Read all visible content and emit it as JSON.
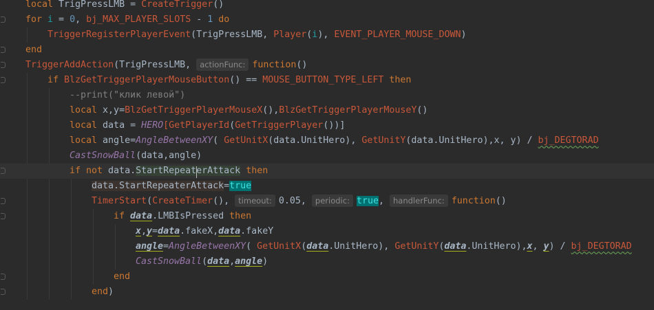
{
  "editor": {
    "language": "lua",
    "current_line": 12,
    "lines": [
      {
        "indent": 0,
        "fold": false,
        "tokens": [
          {
            "t": "local",
            "c": "kw"
          },
          {
            "t": " TrigPressLMB = ",
            "c": "id"
          },
          {
            "t": "CreateTrigger",
            "c": "fn"
          },
          {
            "t": "()",
            "c": "id"
          }
        ]
      },
      {
        "indent": 0,
        "fold": true,
        "tokens": [
          {
            "t": "for ",
            "c": "kw"
          },
          {
            "t": "i",
            "c": "par"
          },
          {
            "t": " = ",
            "c": "id"
          },
          {
            "t": "0",
            "c": "num n"
          },
          {
            "t": ", ",
            "c": "id"
          },
          {
            "t": "bj_MAX_PLAYER_SLOTS",
            "c": "fn"
          },
          {
            "t": " - ",
            "c": "id"
          },
          {
            "t": "1",
            "c": "num n"
          },
          {
            "t": " do",
            "c": "kw"
          }
        ]
      },
      {
        "indent": 1,
        "fold": false,
        "tokens": [
          {
            "t": "TriggerRegisterPlayerEvent",
            "c": "fn"
          },
          {
            "t": "(TrigPressLMB, ",
            "c": "id"
          },
          {
            "t": "Player",
            "c": "fn"
          },
          {
            "t": "(",
            "c": "id"
          },
          {
            "t": "i",
            "c": "par"
          },
          {
            "t": "), ",
            "c": "id"
          },
          {
            "t": "EVENT_PLAYER_MOUSE_DOWN",
            "c": "fn"
          },
          {
            "t": ")",
            "c": "id"
          }
        ]
      },
      {
        "indent": 0,
        "fold": true,
        "tokens": [
          {
            "t": "end",
            "c": "kw"
          }
        ]
      },
      {
        "indent": 0,
        "fold": true,
        "tokens": [
          {
            "t": "TriggerAddAction",
            "c": "fn"
          },
          {
            "t": "(TrigPressLMB, ",
            "c": "id"
          },
          {
            "t": "actionFunc:",
            "c": "hint"
          },
          {
            "t": "function",
            "c": "kw"
          },
          {
            "t": "()",
            "c": "id"
          }
        ]
      },
      {
        "indent": 1,
        "fold": true,
        "tokens": [
          {
            "t": "if ",
            "c": "kw"
          },
          {
            "t": "BlzGetTriggerPlayerMouseButton",
            "c": "fn"
          },
          {
            "t": "() == ",
            "c": "id"
          },
          {
            "t": "MOUSE_BUTTON_TYPE_LEFT",
            "c": "fn"
          },
          {
            "t": " then",
            "c": "kw"
          }
        ]
      },
      {
        "indent": 2,
        "fold": false,
        "tokens": [
          {
            "t": "--print(\"клик левой\")",
            "c": "cm"
          }
        ]
      },
      {
        "indent": 2,
        "fold": false,
        "tokens": [
          {
            "t": "local ",
            "c": "kw"
          },
          {
            "t": "x,y=",
            "c": "id"
          },
          {
            "t": "BlzGetTriggerPlayerMouseX",
            "c": "fn"
          },
          {
            "t": "(),",
            "c": "id"
          },
          {
            "t": "BlzGetTriggerPlayerMouseY",
            "c": "fn"
          },
          {
            "t": "()",
            "c": "id"
          }
        ]
      },
      {
        "indent": 2,
        "fold": false,
        "tokens": [
          {
            "t": "local ",
            "c": "kw"
          },
          {
            "t": "data = ",
            "c": "id"
          },
          {
            "t": "HERO",
            "c": "it"
          },
          {
            "t": "[GetPlayerId",
            "c": "fn"
          },
          {
            "t": "(",
            "c": "id"
          },
          {
            "t": "GetTriggerPlayer",
            "c": "fn"
          },
          {
            "t": "())]",
            "c": "id"
          }
        ]
      },
      {
        "indent": 2,
        "fold": false,
        "tokens": [
          {
            "t": "local ",
            "c": "kw"
          },
          {
            "t": "angle=",
            "c": "id"
          },
          {
            "t": "AngleBetweenXY",
            "c": "it"
          },
          {
            "t": "( ",
            "c": "id"
          },
          {
            "t": "GetUnitX",
            "c": "fn"
          },
          {
            "t": "(data.UnitHero), ",
            "c": "id"
          },
          {
            "t": "GetUnitY",
            "c": "fn"
          },
          {
            "t": "(data.UnitHero),x, y) / ",
            "c": "id"
          },
          {
            "t": "bj_DEGTORAD",
            "c": "wav"
          }
        ]
      },
      {
        "indent": 2,
        "fold": false,
        "tokens": [
          {
            "t": "CastSnowBall",
            "c": "it"
          },
          {
            "t": "(data,angle)",
            "c": "id"
          }
        ]
      },
      {
        "indent": 2,
        "fold": true,
        "tokens": [
          {
            "t": "if not ",
            "c": "kw"
          },
          {
            "t": "data.",
            "c": "id"
          },
          {
            "t": "StartRepeaterAttack",
            "c": "id sel"
          },
          {
            "t": " then",
            "c": "kw"
          }
        ]
      },
      {
        "indent": 3,
        "fold": false,
        "tokens": [
          {
            "t": "data.StartRepeaterAttack",
            "c": "rd"
          },
          {
            "t": "=",
            "c": "id"
          },
          {
            "t": "true",
            "c": "tru"
          }
        ]
      },
      {
        "indent": 3,
        "fold": true,
        "tokens": [
          {
            "t": "TimerStart",
            "c": "fn"
          },
          {
            "t": "(",
            "c": "id"
          },
          {
            "t": "CreateTimer",
            "c": "fn"
          },
          {
            "t": "(), ",
            "c": "id"
          },
          {
            "t": "timeout:",
            "c": "hint"
          },
          {
            "t": "0.05",
            "c": "num"
          },
          {
            "t": ", ",
            "c": "id"
          },
          {
            "t": "periodic:",
            "c": "hint"
          },
          {
            "t": "true",
            "c": "tru"
          },
          {
            "t": ", ",
            "c": "id"
          },
          {
            "t": "handlerFunc:",
            "c": "hint"
          },
          {
            "t": "function",
            "c": "kw"
          },
          {
            "t": "()",
            "c": "id"
          }
        ]
      },
      {
        "indent": 4,
        "fold": true,
        "tokens": [
          {
            "t": "if ",
            "c": "kw"
          },
          {
            "t": "data",
            "c": "ul"
          },
          {
            "t": ".LMBIsPressed",
            "c": "id"
          },
          {
            "t": " then",
            "c": "kw"
          }
        ]
      },
      {
        "indent": 5,
        "fold": false,
        "tokens": [
          {
            "t": "x",
            "c": "ul"
          },
          {
            "t": ",",
            "c": "id"
          },
          {
            "t": "y",
            "c": "ul"
          },
          {
            "t": "=",
            "c": "id"
          },
          {
            "t": "data",
            "c": "ul"
          },
          {
            "t": ".fakeX,",
            "c": "id"
          },
          {
            "t": "data",
            "c": "ul"
          },
          {
            "t": ".fakeY",
            "c": "id"
          }
        ]
      },
      {
        "indent": 5,
        "fold": false,
        "tokens": [
          {
            "t": "angle",
            "c": "ul"
          },
          {
            "t": "=",
            "c": "id"
          },
          {
            "t": "AngleBetweenXY",
            "c": "it"
          },
          {
            "t": "( ",
            "c": "id"
          },
          {
            "t": "GetUnitX",
            "c": "fn"
          },
          {
            "t": "(",
            "c": "id"
          },
          {
            "t": "data",
            "c": "ul"
          },
          {
            "t": ".UnitHero), ",
            "c": "id"
          },
          {
            "t": "GetUnitY",
            "c": "fn"
          },
          {
            "t": "(",
            "c": "id"
          },
          {
            "t": "data",
            "c": "ul"
          },
          {
            "t": ".UnitHero),",
            "c": "id"
          },
          {
            "t": "x",
            "c": "ul"
          },
          {
            "t": ", ",
            "c": "id"
          },
          {
            "t": "y",
            "c": "ul"
          },
          {
            "t": ") / ",
            "c": "id"
          },
          {
            "t": "bj_DEGTORAD",
            "c": "wav"
          }
        ]
      },
      {
        "indent": 5,
        "fold": false,
        "tokens": [
          {
            "t": "CastSnowBall",
            "c": "it"
          },
          {
            "t": "(",
            "c": "id"
          },
          {
            "t": "data",
            "c": "ul"
          },
          {
            "t": ",",
            "c": "id"
          },
          {
            "t": "angle",
            "c": "ul"
          },
          {
            "t": ")",
            "c": "id"
          }
        ]
      },
      {
        "indent": 4,
        "fold": true,
        "tokens": [
          {
            "t": "end",
            "c": "kw"
          }
        ]
      },
      {
        "indent": 3,
        "fold": true,
        "tokens": [
          {
            "t": "end",
            "c": "kw"
          },
          {
            "t": ")",
            "c": "id"
          }
        ]
      }
    ]
  }
}
